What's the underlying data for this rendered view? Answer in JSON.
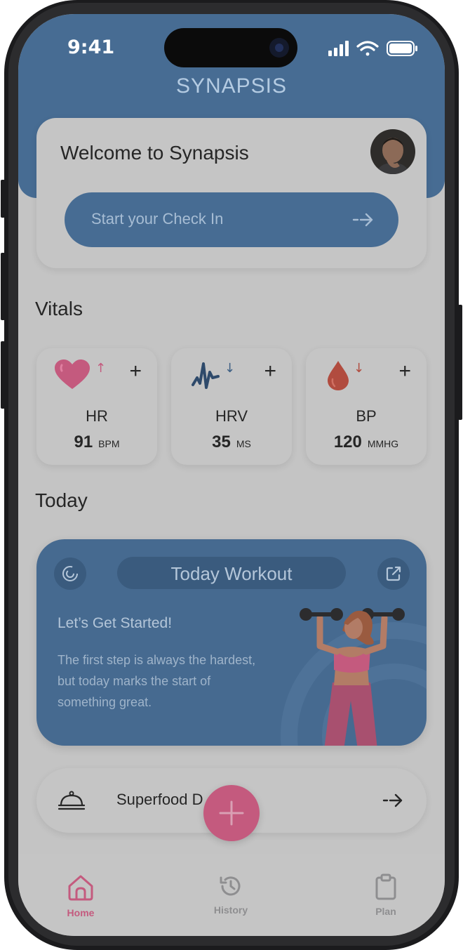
{
  "status_bar": {
    "time": "9:41"
  },
  "app": {
    "brand": "SYNAPSIS"
  },
  "welcome": {
    "title": "Welcome to Synapsis",
    "checkin_label": "Start your Check In"
  },
  "vitals": {
    "section_title": "Vitals",
    "items": [
      {
        "name": "HR",
        "value": "91",
        "unit": "BPM",
        "trend": "up",
        "icon": "heart-icon",
        "color": "#c45a7e"
      },
      {
        "name": "HRV",
        "value": "35",
        "unit": "MS",
        "trend": "down",
        "icon": "pulse-wave-icon",
        "color": "#3d5f84"
      },
      {
        "name": "BP",
        "value": "120",
        "unit": "MMHG",
        "trend": "down",
        "icon": "blood-drop-icon",
        "color": "#b14c3f"
      }
    ]
  },
  "today": {
    "section_title": "Today",
    "workout": {
      "title": "Today Workout",
      "heading": "Let’s Get Started!",
      "body": "The first step is always the hardest, but today marks the start of something great."
    },
    "superfood": {
      "label": "Superfood D"
    }
  },
  "nav": {
    "items": [
      {
        "label": "Home",
        "icon": "home-icon",
        "active": true
      },
      {
        "label": "History",
        "icon": "history-icon",
        "active": false
      },
      {
        "label": "Plan",
        "icon": "clipboard-icon",
        "active": false
      }
    ]
  },
  "colors": {
    "primary": "#476c93",
    "accent": "#c45a7e",
    "card": "#c5c5c5",
    "background": "#c4c4c4"
  }
}
